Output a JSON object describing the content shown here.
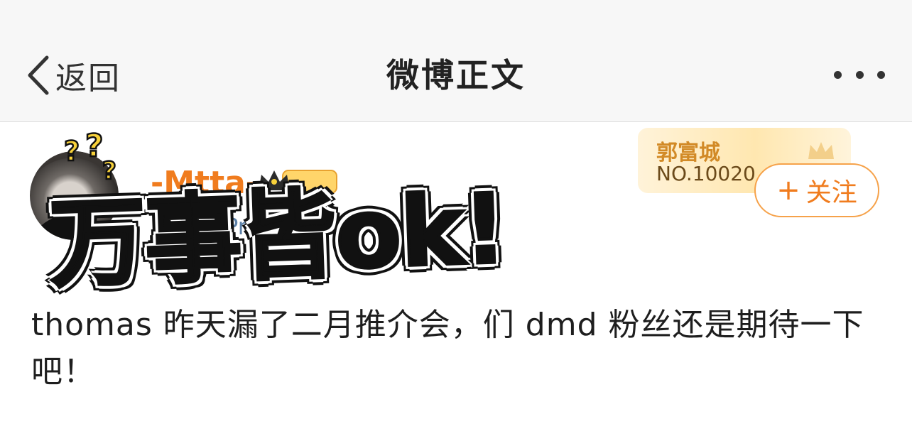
{
  "navbar": {
    "back_label": "返回",
    "title": "微博正文",
    "more_icon": "more-dots-icon"
  },
  "post": {
    "username": "-Mtta-",
    "source_prefix": "",
    "source_device": "ne 14 Pro",
    "fan_badge": {
      "name": "郭富城",
      "number": "NO.10020"
    },
    "follow_label": "关注",
    "sticker_text": "万事皆ok!",
    "text": "thomas 昨天漏了二月推介会，们 dmd 粉丝还是期待一下吧！"
  },
  "colors": {
    "accent": "#f07c1e",
    "link": "#5b7fa6",
    "nav_bg": "#f7f7f7"
  }
}
